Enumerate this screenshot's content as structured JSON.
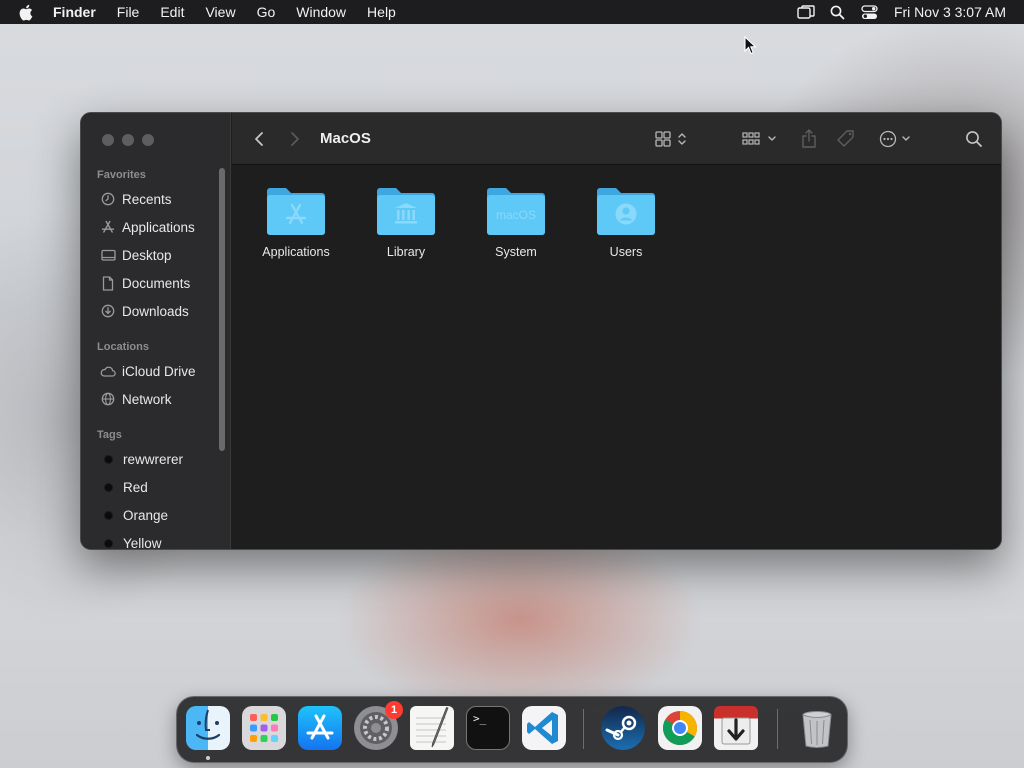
{
  "menubar": {
    "app_name": "Finder",
    "menus": [
      "File",
      "Edit",
      "View",
      "Go",
      "Window",
      "Help"
    ],
    "datetime": "Fri Nov 3  3:07 AM",
    "icons": [
      "apple-logo",
      "display-mirroring-icon",
      "spotlight-search-icon",
      "control-center-icon"
    ]
  },
  "finder": {
    "title": "MacOS",
    "sidebar": {
      "favorites_label": "Favorites",
      "favorites": [
        {
          "label": "Recents",
          "icon": "clock-icon"
        },
        {
          "label": "Applications",
          "icon": "applications-icon"
        },
        {
          "label": "Desktop",
          "icon": "desktop-icon"
        },
        {
          "label": "Documents",
          "icon": "document-icon"
        },
        {
          "label": "Downloads",
          "icon": "download-icon"
        }
      ],
      "locations_label": "Locations",
      "locations": [
        {
          "label": "iCloud Drive",
          "icon": "cloud-icon"
        },
        {
          "label": "Network",
          "icon": "globe-icon"
        }
      ],
      "tags_label": "Tags",
      "tags": [
        {
          "label": "rewwrerer"
        },
        {
          "label": "Red"
        },
        {
          "label": "Orange"
        },
        {
          "label": "Yellow"
        }
      ]
    },
    "folders": [
      {
        "label": "Applications",
        "glyph": "app-store-glyph"
      },
      {
        "label": "Library",
        "glyph": "library-glyph"
      },
      {
        "label": "System",
        "glyph_text": "macOS"
      },
      {
        "label": "Users",
        "glyph": "user-glyph"
      }
    ],
    "folder_color": "#5ec8f6"
  },
  "dock": {
    "apps": [
      "Finder",
      "Launchpad",
      "App Store",
      "System Settings",
      "TextEdit",
      "Terminal",
      "Visual Studio Code",
      "Steam",
      "Google Chrome",
      "Installer",
      "Trash"
    ],
    "settings_badge": "1",
    "terminal_prompt": ">_"
  }
}
